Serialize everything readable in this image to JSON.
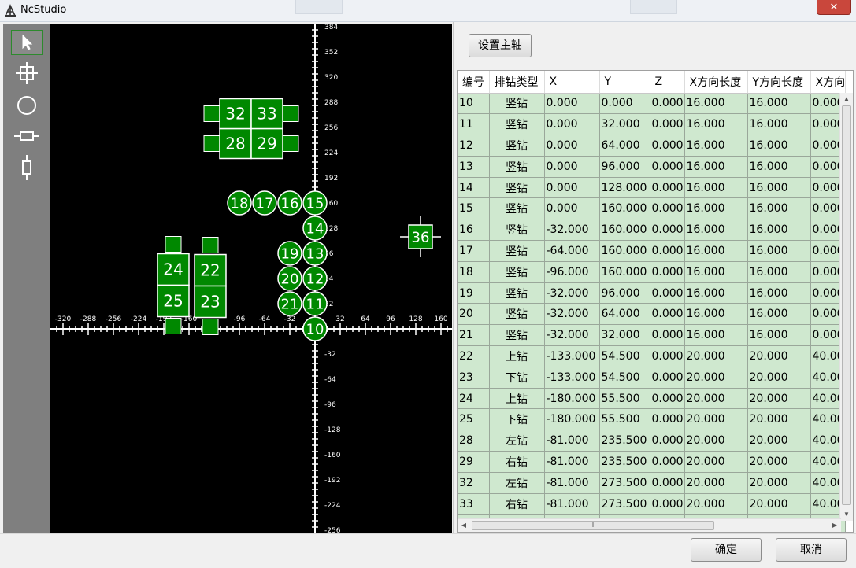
{
  "window": {
    "title": "NcStudio",
    "close_label": "✕"
  },
  "toolbar": {
    "tools": [
      {
        "icon": "arrow-pointer-icon"
      },
      {
        "icon": "crosshair-square-icon"
      },
      {
        "icon": "circle-icon"
      },
      {
        "icon": "horizontal-drill-icon"
      },
      {
        "icon": "vertical-drill-icon"
      }
    ]
  },
  "canvas": {
    "x_ticks": [
      "-320",
      "-288",
      "-256",
      "-224",
      "-192",
      "-160",
      "-96",
      "-64",
      "-32",
      "32",
      "64",
      "96",
      "128",
      "160"
    ],
    "y_ticks": [
      "384",
      "352",
      "320",
      "288",
      "256",
      "224",
      "192",
      "160",
      "128",
      "96",
      "64",
      "32",
      "-32",
      "-64",
      "-96",
      "-128",
      "-160",
      "-192",
      "-224",
      "-256"
    ],
    "holes": [
      {
        "id": "10",
        "shape": "circle"
      },
      {
        "id": "11",
        "shape": "circle"
      },
      {
        "id": "12",
        "shape": "circle"
      },
      {
        "id": "13",
        "shape": "circle"
      },
      {
        "id": "14",
        "shape": "circle"
      },
      {
        "id": "15",
        "shape": "circle"
      },
      {
        "id": "16",
        "shape": "circle"
      },
      {
        "id": "17",
        "shape": "circle"
      },
      {
        "id": "18",
        "shape": "circle"
      },
      {
        "id": "19",
        "shape": "circle"
      },
      {
        "id": "20",
        "shape": "circle"
      },
      {
        "id": "21",
        "shape": "circle"
      },
      {
        "id": "22",
        "shape": "vertical-box"
      },
      {
        "id": "23",
        "shape": "vertical-box"
      },
      {
        "id": "24",
        "shape": "vertical-box"
      },
      {
        "id": "25",
        "shape": "vertical-box"
      },
      {
        "id": "28",
        "shape": "horizontal-box"
      },
      {
        "id": "29",
        "shape": "horizontal-box"
      },
      {
        "id": "32",
        "shape": "horizontal-box"
      },
      {
        "id": "33",
        "shape": "horizontal-box"
      },
      {
        "id": "36",
        "shape": "spindle-square"
      }
    ],
    "accent_color": "#008800"
  },
  "panel": {
    "set_spindle_label": "设置主轴",
    "columns": [
      "编号",
      "排钻类型",
      "X",
      "Y",
      "Z",
      "X方向长度",
      "Y方向长度",
      "X方向"
    ],
    "rows": [
      [
        "10",
        "竖钻",
        "0.000",
        "0.000",
        "0.000",
        "16.000",
        "16.000",
        "0.000"
      ],
      [
        "11",
        "竖钻",
        "0.000",
        "32.000",
        "0.000",
        "16.000",
        "16.000",
        "0.000"
      ],
      [
        "12",
        "竖钻",
        "0.000",
        "64.000",
        "0.000",
        "16.000",
        "16.000",
        "0.000"
      ],
      [
        "13",
        "竖钻",
        "0.000",
        "96.000",
        "0.000",
        "16.000",
        "16.000",
        "0.000"
      ],
      [
        "14",
        "竖钻",
        "0.000",
        "128.000",
        "0.000",
        "16.000",
        "16.000",
        "0.000"
      ],
      [
        "15",
        "竖钻",
        "0.000",
        "160.000",
        "0.000",
        "16.000",
        "16.000",
        "0.000"
      ],
      [
        "16",
        "竖钻",
        "-32.000",
        "160.000",
        "0.000",
        "16.000",
        "16.000",
        "0.000"
      ],
      [
        "17",
        "竖钻",
        "-64.000",
        "160.000",
        "0.000",
        "16.000",
        "16.000",
        "0.000"
      ],
      [
        "18",
        "竖钻",
        "-96.000",
        "160.000",
        "0.000",
        "16.000",
        "16.000",
        "0.000"
      ],
      [
        "19",
        "竖钻",
        "-32.000",
        "96.000",
        "0.000",
        "16.000",
        "16.000",
        "0.000"
      ],
      [
        "20",
        "竖钻",
        "-32.000",
        "64.000",
        "0.000",
        "16.000",
        "16.000",
        "0.000"
      ],
      [
        "21",
        "竖钻",
        "-32.000",
        "32.000",
        "0.000",
        "16.000",
        "16.000",
        "0.000"
      ],
      [
        "22",
        "上钻",
        "-133.000",
        "54.500",
        "0.000",
        "20.000",
        "20.000",
        "40.00"
      ],
      [
        "23",
        "下钻",
        "-133.000",
        "54.500",
        "0.000",
        "20.000",
        "20.000",
        "40.00"
      ],
      [
        "24",
        "上钻",
        "-180.000",
        "55.500",
        "0.000",
        "20.000",
        "20.000",
        "40.00"
      ],
      [
        "25",
        "下钻",
        "-180.000",
        "55.500",
        "0.000",
        "20.000",
        "20.000",
        "40.00"
      ],
      [
        "28",
        "左钻",
        "-81.000",
        "235.500",
        "0.000",
        "20.000",
        "20.000",
        "40.00"
      ],
      [
        "29",
        "右钻",
        "-81.000",
        "235.500",
        "0.000",
        "20.000",
        "20.000",
        "40.00"
      ],
      [
        "32",
        "左钻",
        "-81.000",
        "273.500",
        "0.000",
        "20.000",
        "20.000",
        "40.00"
      ],
      [
        "33",
        "右钻",
        "-81.000",
        "273.500",
        "0.000",
        "20.000",
        "20.000",
        "40.00"
      ],
      [
        "",
        "",
        "",
        "",
        "",
        "",
        "",
        ""
      ]
    ],
    "hscroll_grip": "III"
  },
  "footer": {
    "ok_label": "确定",
    "cancel_label": "取消"
  }
}
